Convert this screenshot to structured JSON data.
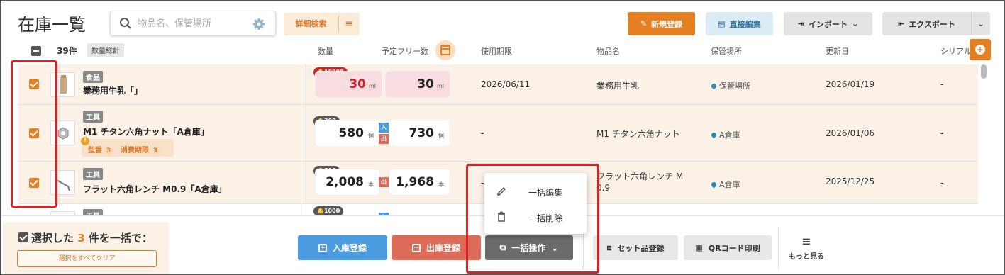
{
  "header": {
    "title": "在庫一覧",
    "search_placeholder": "物品名、保管場所",
    "advanced_search": "詳細検索",
    "new_button": "新規登録",
    "direct_edit_button": "直接編集",
    "import_button": "インポート",
    "export_button": "エクスポート"
  },
  "list": {
    "count": "39件",
    "qty_total": "数量総計",
    "columns": {
      "qty": "数量",
      "free_qty": "予定フリー数",
      "expiry": "使用期限",
      "item_name": "物品名",
      "location": "保管場所",
      "updated": "更新日",
      "serial": "シリアル"
    },
    "rows": [
      {
        "category": "食品",
        "name": "業務用牛乳「」",
        "alert": "10000",
        "qty": "30",
        "qty_unit": "ml",
        "free": "30",
        "free_unit": "ml",
        "expiry": "2026/06/11",
        "item_name": "業務用牛乳",
        "location": "保管場所",
        "updated": "2026/01/19",
        "serial": "-"
      },
      {
        "category": "工具",
        "name": "M1 チタン六角ナット「A倉庫」",
        "alert": "300",
        "qty": "580",
        "qty_unit": "個",
        "in_label": "入",
        "out_label": "出",
        "free": "730",
        "free_unit": "個",
        "tag1": "型番",
        "tag1_count": "3",
        "tag2": "消費期限",
        "tag2_count": "3",
        "expiry": "-",
        "item_name": "M1 チタン六角ナット",
        "location": "A倉庫",
        "updated": "2026/01/06",
        "serial": "-"
      },
      {
        "category": "工具",
        "name": "フラット六角レンチ M0.9「A倉庫」",
        "alert": "500",
        "qty": "2,008",
        "qty_unit": "本",
        "out_label": "出",
        "free": "1,968",
        "free_unit": "本",
        "expiry": "-",
        "item_name_line1": "フラット六角レンチ M",
        "item_name_line2": "0.9",
        "location": "A倉庫",
        "updated": "2025/12/25",
        "serial": "-"
      },
      {
        "category": "工具",
        "alert": "1000",
        "in_label": "入"
      }
    ]
  },
  "context_menu": {
    "bulk_edit": "一括編集",
    "bulk_delete": "一括削除"
  },
  "footer": {
    "selected_prefix": "選択した",
    "selected_count": "3",
    "selected_suffix": "件を一括で：",
    "clear_all": "選択をすべてクリア",
    "stock_in": "入庫登録",
    "stock_out": "出庫登録",
    "bulk_ops": "一括操作",
    "set_register": "セット品登録",
    "qr_print": "QRコード印刷",
    "more": "もっと見る"
  },
  "colors": {
    "accent": "#e67e22",
    "annotation": "#e02020",
    "in": "#4a9be0",
    "out": "#dd6b5a"
  }
}
